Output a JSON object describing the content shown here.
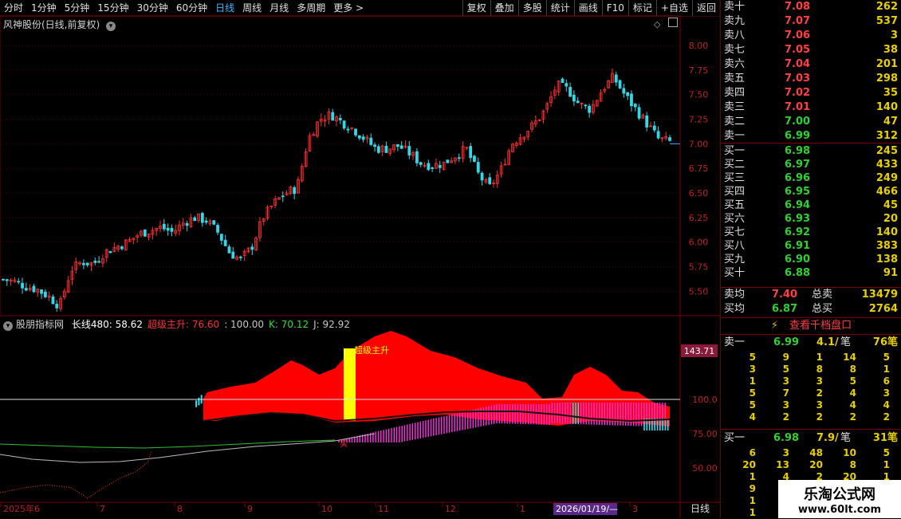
{
  "toolbar": {
    "periods": [
      "分时",
      "1分钟",
      "5分钟",
      "15分钟",
      "30分钟",
      "60分钟",
      "日线",
      "周线",
      "月线",
      "多周期",
      "更多 >"
    ],
    "active": "日线",
    "tools": [
      "复权",
      "叠加",
      "多股",
      "统计",
      "画线",
      "F10",
      "标记",
      "+自选",
      "返回"
    ]
  },
  "main_chart": {
    "title": "风神股份(日线,前复权)",
    "y_ticks": [
      "8.00",
      "7.75",
      "7.50",
      "7.25",
      "7.00",
      "6.75",
      "6.50",
      "6.25",
      "6.00",
      "5.75",
      "5.50"
    ]
  },
  "indicator": {
    "name": "股朋指标网",
    "values_text": [
      {
        "label": "长线480: 58.62",
        "color": "#ffffff"
      },
      {
        "label": "超级主升: 76.60",
        "color": "#ff3030"
      },
      {
        "label": ": 100.00",
        "color": "#c8c8c8"
      },
      {
        "label": "K: 70.12",
        "color": "#30e030"
      },
      {
        "label": "J: 92.92",
        "color": "#c8c8c8"
      }
    ],
    "label_inside": "超级主升",
    "marker_text": "买",
    "y_ticks": [
      "100.0",
      "75.00",
      "50.00"
    ],
    "highlight_value": "143.71"
  },
  "x_axis": {
    "labels": [
      "2025年6",
      "7",
      "8",
      "9",
      "10",
      "11",
      "12",
      "1",
      "2026/01/19/—",
      "3"
    ],
    "period_label": "日线"
  },
  "chart_data": {
    "type": "candlestick",
    "title": "风神股份(日线,前复权)",
    "x_months": [
      "2025年6",
      "7",
      "8",
      "9",
      "10",
      "11",
      "12",
      "1",
      "2",
      "3"
    ],
    "y_range": [
      5.3,
      8.3
    ],
    "close_path": [
      5.62,
      5.6,
      5.55,
      5.52,
      5.45,
      5.35,
      5.72,
      5.8,
      5.78,
      5.9,
      5.95,
      6.0,
      6.08,
      6.12,
      6.15,
      6.1,
      6.2,
      6.25,
      6.22,
      6.1,
      5.9,
      5.82,
      5.95,
      6.25,
      6.4,
      6.5,
      6.55,
      7.05,
      7.25,
      7.3,
      7.22,
      7.15,
      7.05,
      6.95,
      6.95,
      6.98,
      6.9,
      6.8,
      6.78,
      6.8,
      6.88,
      6.95,
      6.7,
      6.55,
      6.72,
      7.0,
      7.1,
      7.2,
      7.35,
      7.6,
      7.55,
      7.4,
      7.35,
      7.55,
      7.68,
      7.5,
      7.35,
      7.2,
      7.05,
      7.02
    ],
    "indicator_range": [
      25,
      150
    ],
    "reference_line": 100
  },
  "order_book": {
    "asks": [
      {
        "label": "卖十",
        "price": "7.08",
        "vol": "262"
      },
      {
        "label": "卖九",
        "price": "7.07",
        "vol": "537"
      },
      {
        "label": "卖八",
        "price": "7.06",
        "vol": "3"
      },
      {
        "label": "卖七",
        "price": "7.05",
        "vol": "38"
      },
      {
        "label": "卖六",
        "price": "7.04",
        "vol": "201"
      },
      {
        "label": "卖五",
        "price": "7.03",
        "vol": "298"
      },
      {
        "label": "卖四",
        "price": "7.02",
        "vol": "35"
      },
      {
        "label": "卖三",
        "price": "7.01",
        "vol": "140"
      },
      {
        "label": "卖二",
        "price": "7.00",
        "vol": "47"
      },
      {
        "label": "卖一",
        "price": "6.99",
        "vol": "312"
      }
    ],
    "bids": [
      {
        "label": "买一",
        "price": "6.98",
        "vol": "245"
      },
      {
        "label": "买二",
        "price": "6.97",
        "vol": "433"
      },
      {
        "label": "买三",
        "price": "6.96",
        "vol": "249"
      },
      {
        "label": "买四",
        "price": "6.95",
        "vol": "466"
      },
      {
        "label": "买五",
        "price": "6.94",
        "vol": "45"
      },
      {
        "label": "买六",
        "price": "6.93",
        "vol": "20"
      },
      {
        "label": "买七",
        "price": "6.92",
        "vol": "140"
      },
      {
        "label": "买八",
        "price": "6.91",
        "vol": "383"
      },
      {
        "label": "买九",
        "price": "6.90",
        "vol": "138"
      },
      {
        "label": "买十",
        "price": "6.88",
        "vol": "91"
      }
    ],
    "avg_sell": {
      "label": "卖均",
      "price": "7.40",
      "total_label": "总卖",
      "total": "13479"
    },
    "avg_buy": {
      "label": "买均",
      "price": "6.87",
      "total_label": "总买",
      "total": "2764"
    },
    "view_button": "查看千档盘口",
    "sell1": {
      "label": "卖一",
      "price": "6.99",
      "per": "4.1/",
      "unit": "笔",
      "count": "76笔"
    },
    "sell1_grid": [
      [
        "5",
        "9",
        "1",
        "14",
        "5"
      ],
      [
        "3",
        "5",
        "8",
        "8",
        "1"
      ],
      [
        "1",
        "3",
        "3",
        "5",
        "6"
      ],
      [
        "5",
        "7",
        "2",
        "4",
        "3"
      ],
      [
        "5",
        "3",
        "3",
        "4",
        "4"
      ],
      [
        "4",
        "2",
        "2",
        "2",
        "2"
      ]
    ],
    "buy1": {
      "label": "买一",
      "price": "6.98",
      "per": "7.9/",
      "unit": "笔",
      "count": "31笔"
    },
    "buy1_grid": [
      [
        "6",
        "3",
        "48",
        "10",
        "5"
      ],
      [
        "20",
        "13",
        "20",
        "8",
        "1"
      ],
      [
        "1",
        "4",
        "2",
        "20",
        "1"
      ],
      [
        "9",
        "1",
        "",
        "",
        ""
      ],
      [
        "1",
        "",
        "",
        "",
        ""
      ],
      [
        "1",
        "",
        "",
        "",
        ""
      ]
    ]
  },
  "watermark": {
    "line1": "乐淘公式网",
    "line2": "www.60lt.com"
  }
}
